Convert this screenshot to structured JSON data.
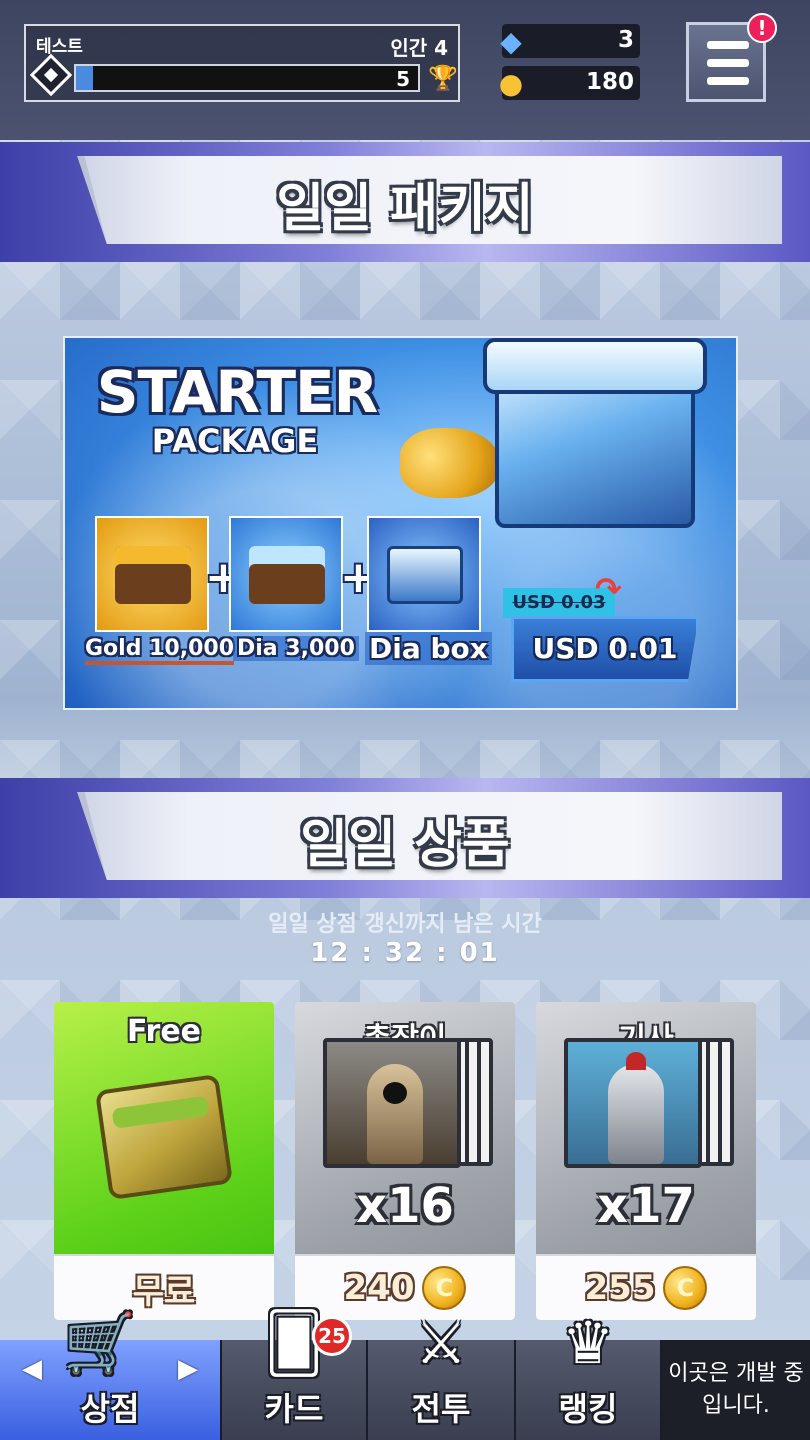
{
  "hud": {
    "player_name": "테스트",
    "player_class": "인간 4",
    "level": "5",
    "xp_fraction": 0.05,
    "diamonds": "3",
    "gold": "180",
    "menu_badge": "!"
  },
  "sections": {
    "daily_package_title": "일일 패키지",
    "daily_goods_title": "일일 상품"
  },
  "starter": {
    "title": "STARTER",
    "subtitle": "PACKAGE",
    "items": [
      {
        "label": "Gold 10,000"
      },
      {
        "label": "Dia 3,000"
      },
      {
        "label": "Dia box"
      }
    ],
    "plus": "+",
    "old_price": "USD 0.03",
    "price": "USD 0.01"
  },
  "daily": {
    "timer_label": "일일 상점 갱신까지 남은 시간",
    "timer_value": "12 : 32 : 01",
    "products": [
      {
        "name": "Free",
        "price_label": "무료"
      },
      {
        "name": "총잡이",
        "qty": "x16",
        "price": "240"
      },
      {
        "name": "기사",
        "qty": "x17",
        "price": "255"
      }
    ]
  },
  "nav": {
    "shop": "상점",
    "cards": "카드",
    "cards_badge": "25",
    "battle": "전투",
    "ranking": "랭킹",
    "dev_notice": "이곳은 개발 중입니다."
  },
  "colors": {
    "accent_blue": "#3a5fe0",
    "free_green": "#5fd21a",
    "badge_red": "#e12828"
  }
}
